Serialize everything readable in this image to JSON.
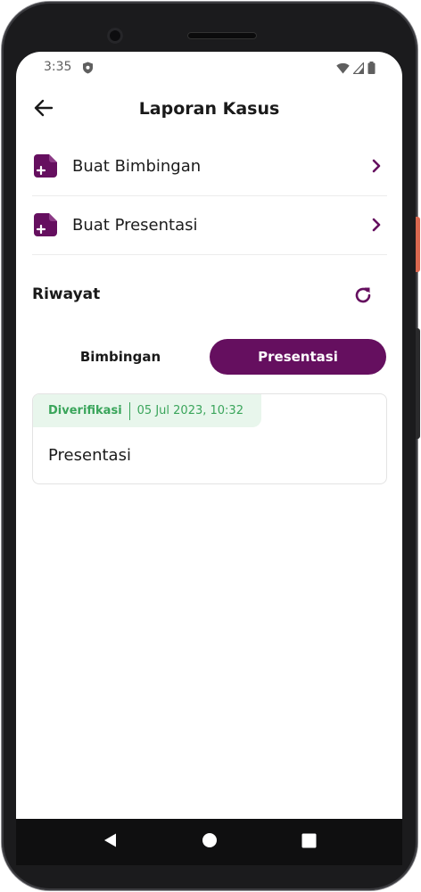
{
  "status_bar": {
    "time": "3:35",
    "icons": [
      "shield-icon",
      "wifi-icon",
      "signal-icon",
      "battery-icon"
    ]
  },
  "app_bar": {
    "title": "Laporan Kasus",
    "back_icon": "arrow-left-icon"
  },
  "menu": {
    "items": [
      {
        "label": "Buat Bimbingan",
        "icon": "add-document-icon"
      },
      {
        "label": "Buat Presentasi",
        "icon": "add-document-icon"
      }
    ]
  },
  "history": {
    "title": "Riwayat",
    "refresh_icon": "refresh-icon",
    "tabs": [
      {
        "label": "Bimbingan",
        "active": false
      },
      {
        "label": "Presentasi",
        "active": true
      }
    ],
    "cards": [
      {
        "status": "Diverifikasi",
        "date": "05 Jul 2023, 10:32",
        "title": "Presentasi"
      }
    ]
  },
  "colors": {
    "primary": "#650f5f",
    "verified": "#3aa55b",
    "verified_bg": "#e8f6ec"
  },
  "nav_bar": {
    "buttons": [
      "back-triangle-icon",
      "home-circle-icon",
      "recents-square-icon"
    ]
  }
}
